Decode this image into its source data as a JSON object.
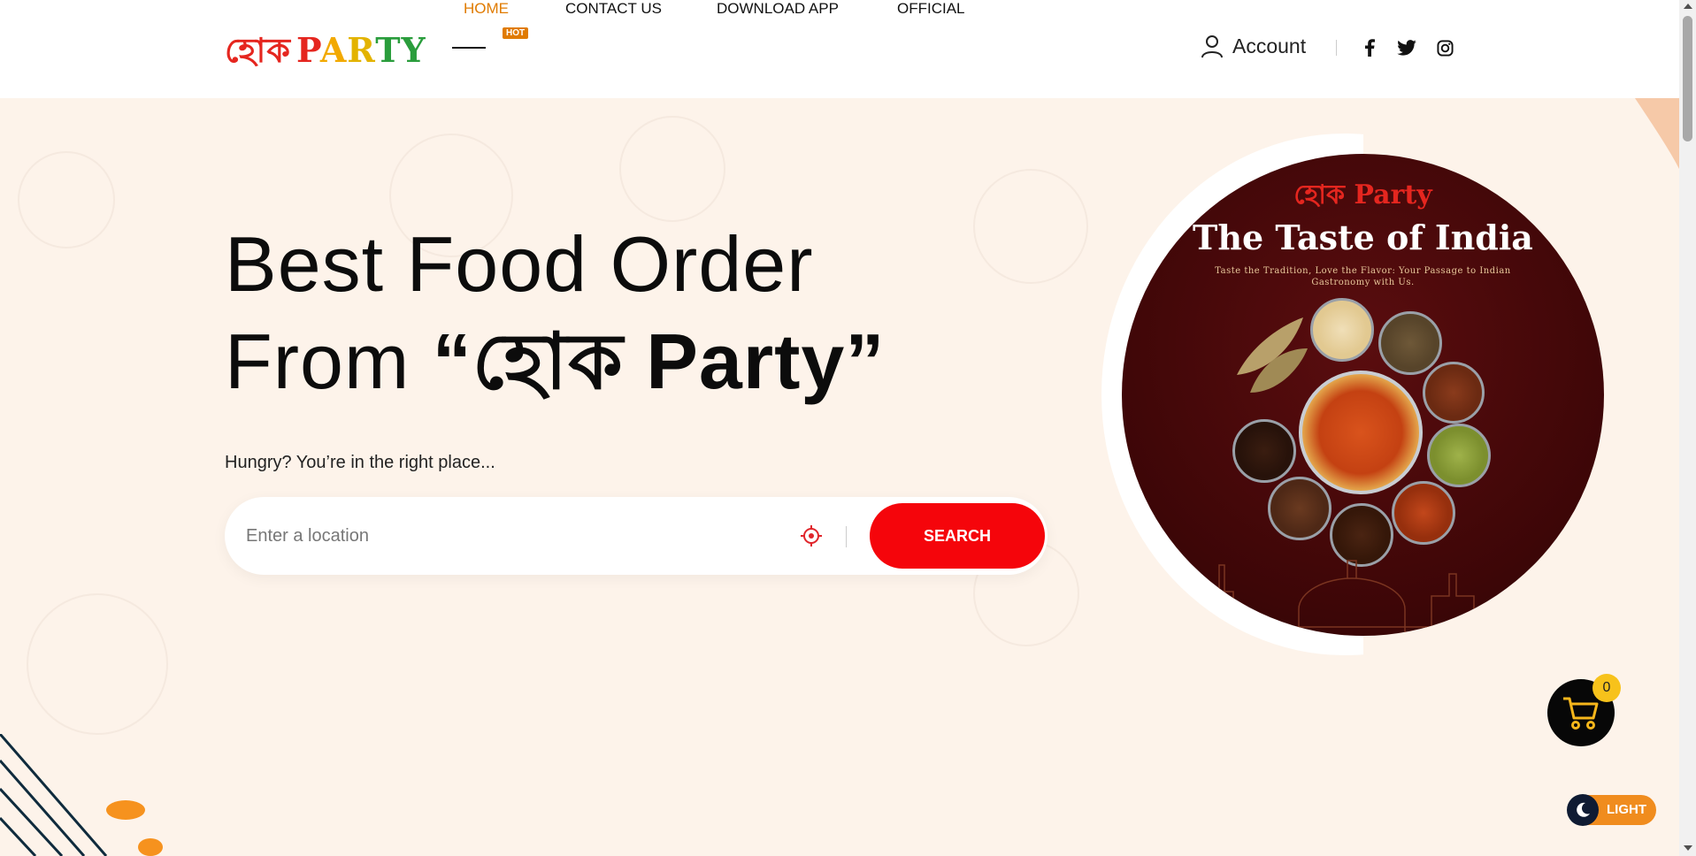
{
  "brand": {
    "logo_part1": "হোক",
    "logo_part2": "Party"
  },
  "nav": {
    "items": [
      {
        "label": "HOME",
        "badge": "HOT",
        "active": true
      },
      {
        "label": "CONTACT US"
      },
      {
        "label": "DOWNLOAD APP"
      },
      {
        "label": "OFFICIAL"
      }
    ]
  },
  "account": {
    "label": "Account"
  },
  "social": [
    "facebook-icon",
    "twitter-icon",
    "instagram-icon"
  ],
  "hero": {
    "headline_line1": "Best Food Order",
    "headline_line2_prefix": "From ",
    "headline_brand": "“হোক Party”",
    "tagline": "Hungry? You’re in the right place...",
    "search": {
      "placeholder": "Enter a location",
      "button": "SEARCH"
    }
  },
  "poster": {
    "logo": "হোক Party",
    "title": "The Taste of India",
    "subtitle": "Taste the Tradition, Love the Flavor: Your Passage to Indian Gastronomy with Us."
  },
  "cart": {
    "count": "0"
  },
  "theme_toggle": {
    "label": "LIGHT"
  },
  "colors": {
    "accent_red": "#f5050b",
    "nav_active": "#e07b00",
    "hero_bg": "#fdf3ea",
    "cart_badge": "#f7c21b",
    "toggle": "#f08c1e"
  }
}
